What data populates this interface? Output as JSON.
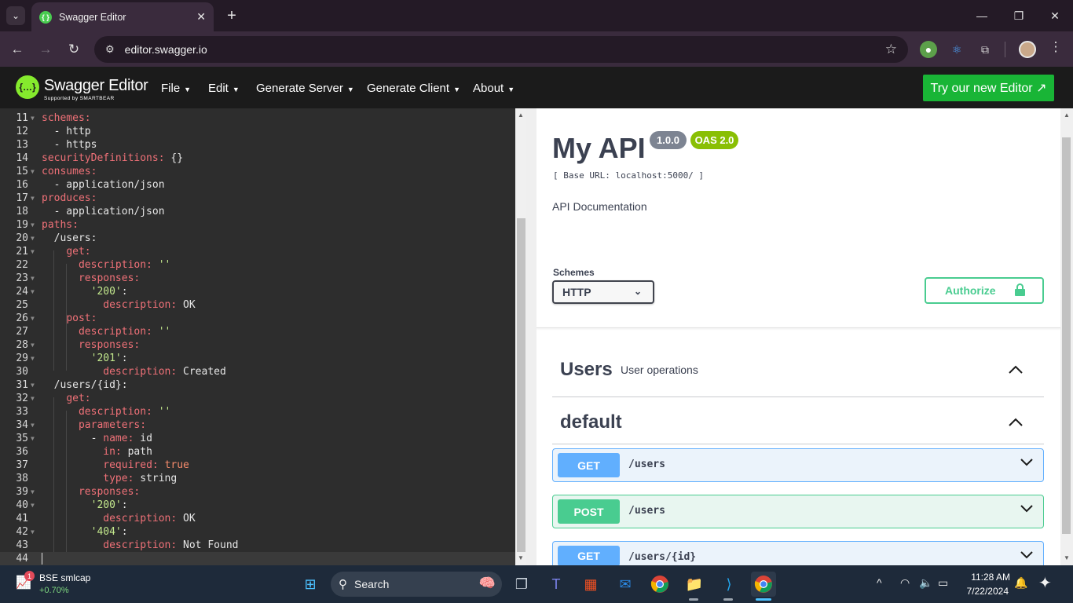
{
  "browser": {
    "tab_title": "Swagger Editor",
    "url": "editor.swagger.io"
  },
  "header": {
    "logo_text": "Swagger Editor",
    "logo_sub": "Supported by SMARTBEAR",
    "menus": [
      "File",
      "Edit",
      "Generate Server",
      "Generate Client",
      "About"
    ],
    "try_button": "Try our new Editor ↗"
  },
  "editor": {
    "lines": [
      {
        "n": "11",
        "fold": true,
        "html": "<span class='k'>schemes:</span>"
      },
      {
        "n": "12",
        "fold": false,
        "html": "  - http"
      },
      {
        "n": "13",
        "fold": false,
        "html": "  - https"
      },
      {
        "n": "14",
        "fold": false,
        "html": "<span class='k'>securityDefinitions:</span> {}"
      },
      {
        "n": "15",
        "fold": true,
        "html": "<span class='k'>consumes:</span>"
      },
      {
        "n": "16",
        "fold": false,
        "html": "  - application/json"
      },
      {
        "n": "17",
        "fold": true,
        "html": "<span class='k'>produces:</span>"
      },
      {
        "n": "18",
        "fold": false,
        "html": "  - application/json"
      },
      {
        "n": "19",
        "fold": true,
        "html": "<span class='k'>paths:</span>"
      },
      {
        "n": "20",
        "fold": true,
        "html": "  /users:"
      },
      {
        "n": "21",
        "fold": true,
        "html": "    <span class='k'>get:</span>"
      },
      {
        "n": "22",
        "fold": false,
        "html": "      <span class='k'>description:</span> <span class='s'>''</span>"
      },
      {
        "n": "23",
        "fold": true,
        "html": "      <span class='k'>responses:</span>"
      },
      {
        "n": "24",
        "fold": true,
        "html": "        <span class='s'>'200'</span>:"
      },
      {
        "n": "25",
        "fold": false,
        "html": "          <span class='k'>description:</span> OK"
      },
      {
        "n": "26",
        "fold": true,
        "html": "    <span class='k'>post:</span>"
      },
      {
        "n": "27",
        "fold": false,
        "html": "      <span class='k'>description:</span> <span class='s'>''</span>"
      },
      {
        "n": "28",
        "fold": true,
        "html": "      <span class='k'>responses:</span>"
      },
      {
        "n": "29",
        "fold": true,
        "html": "        <span class='s'>'201'</span>:"
      },
      {
        "n": "30",
        "fold": false,
        "html": "          <span class='k'>description:</span> Created"
      },
      {
        "n": "31",
        "fold": true,
        "html": "  /users/{id}:"
      },
      {
        "n": "32",
        "fold": true,
        "html": "    <span class='k'>get:</span>"
      },
      {
        "n": "33",
        "fold": false,
        "html": "      <span class='k'>description:</span> <span class='s'>''</span>"
      },
      {
        "n": "34",
        "fold": true,
        "html": "      <span class='k'>parameters:</span>"
      },
      {
        "n": "35",
        "fold": true,
        "html": "        - <span class='k'>name:</span> id"
      },
      {
        "n": "36",
        "fold": false,
        "html": "          <span class='k'>in:</span> path"
      },
      {
        "n": "37",
        "fold": false,
        "html": "          <span class='k'>required:</span> <span class='b'>true</span>"
      },
      {
        "n": "38",
        "fold": false,
        "html": "          <span class='k'>type:</span> string"
      },
      {
        "n": "39",
        "fold": true,
        "html": "      <span class='k'>responses:</span>"
      },
      {
        "n": "40",
        "fold": true,
        "html": "        <span class='s'>'200'</span>:"
      },
      {
        "n": "41",
        "fold": false,
        "html": "          <span class='k'>description:</span> OK"
      },
      {
        "n": "42",
        "fold": true,
        "html": "        <span class='s'>'404'</span>:"
      },
      {
        "n": "43",
        "fold": false,
        "html": "          <span class='k'>description:</span> Not Found"
      },
      {
        "n": "44",
        "fold": false,
        "html": ""
      }
    ]
  },
  "preview": {
    "title": "My API",
    "version_badge": "1.0.0",
    "oas_badge": "OAS 2.0",
    "base_url": "[ Base URL: localhost:5000/ ]",
    "description": "API Documentation",
    "schemes_label": "Schemes",
    "scheme_selected": "HTTP",
    "authorize_label": "Authorize",
    "tags": [
      {
        "name": "Users",
        "description": "User operations"
      },
      {
        "name": "default",
        "description": ""
      }
    ],
    "operations": [
      {
        "method": "GET",
        "path": "/users"
      },
      {
        "method": "POST",
        "path": "/users"
      },
      {
        "method": "GET",
        "path": "/users/{id}"
      }
    ]
  },
  "taskbar": {
    "stock_badge": "1",
    "stock_name": "BSE smlcap",
    "stock_change": "+0.70%",
    "search_label": "Search",
    "time": "11:28 AM",
    "date": "7/22/2024"
  },
  "colors": {
    "get": "#61affe",
    "post": "#49cc90",
    "swagger_green": "#85ea2d",
    "try_button": "#19b536"
  }
}
